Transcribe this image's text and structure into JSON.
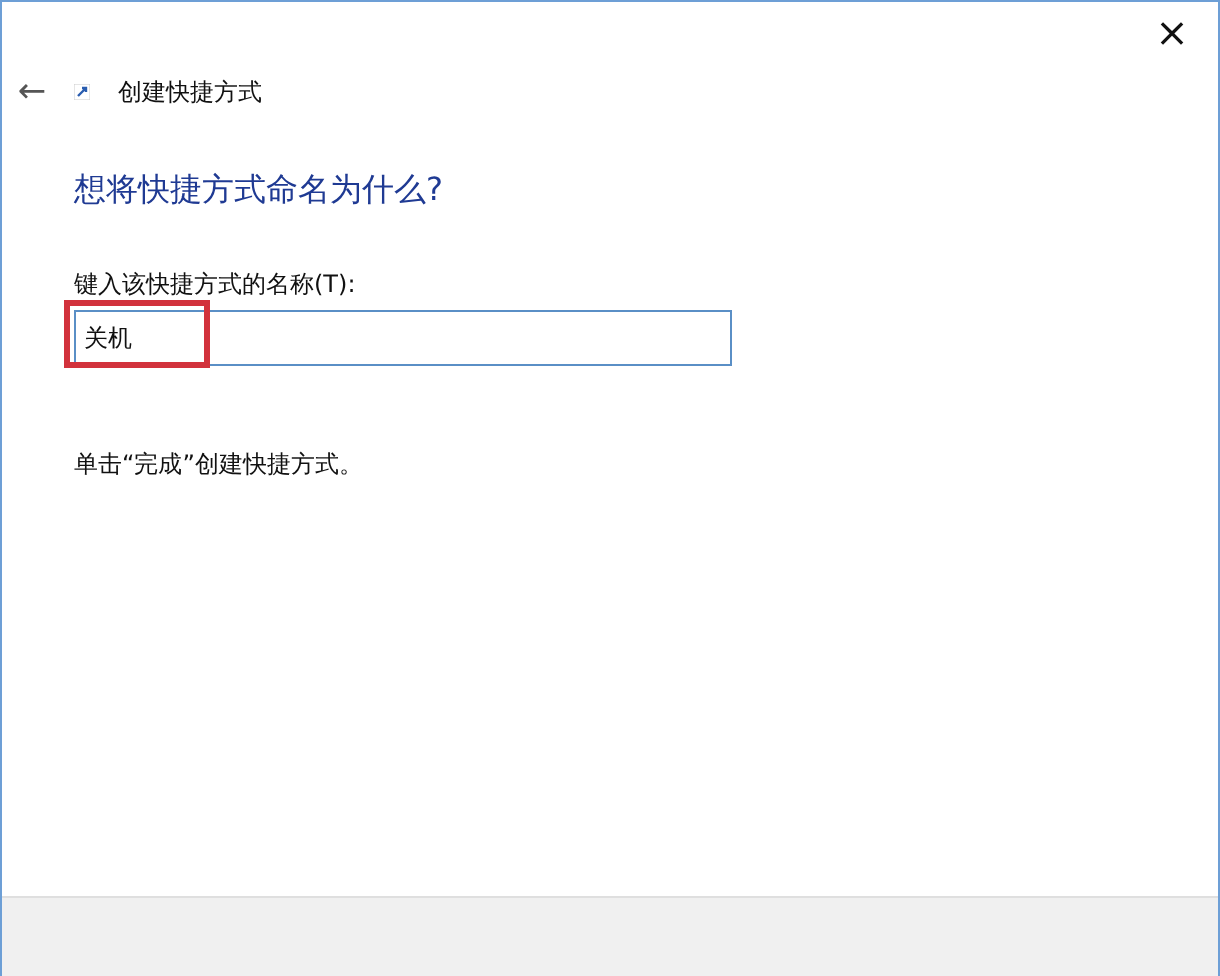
{
  "window": {
    "close": "×"
  },
  "header": {
    "back": "←",
    "title": "创建快捷方式"
  },
  "heading": "想将快捷方式命名为什么?",
  "name_field": {
    "label": "键入该快捷方式的名称(T):",
    "value": "关机",
    "highlighted": true
  },
  "instruction": "单击“完成”创建快捷方式。"
}
